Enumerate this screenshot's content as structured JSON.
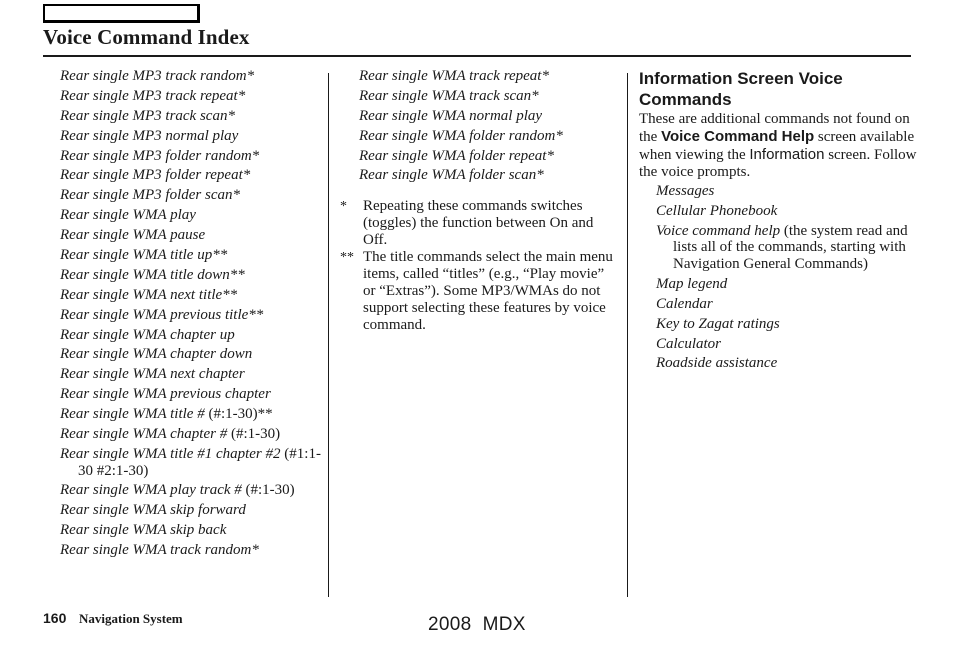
{
  "header": {
    "title": "Voice Command Index"
  },
  "column1": {
    "commands": [
      {
        "text": "Rear single MP3 track random*",
        "suffix": ""
      },
      {
        "text": "Rear single MP3 track repeat*",
        "suffix": ""
      },
      {
        "text": "Rear single MP3 track scan*",
        "suffix": ""
      },
      {
        "text": "Rear single MP3 normal play",
        "suffix": ""
      },
      {
        "text": "Rear single MP3 folder random*",
        "suffix": ""
      },
      {
        "text": "Rear single MP3 folder repeat*",
        "suffix": ""
      },
      {
        "text": "Rear single MP3 folder scan*",
        "suffix": ""
      },
      {
        "text": "Rear single WMA play",
        "suffix": ""
      },
      {
        "text": "Rear single WMA pause",
        "suffix": ""
      },
      {
        "text": "Rear single WMA title up**",
        "suffix": ""
      },
      {
        "text": "Rear single WMA title down**",
        "suffix": ""
      },
      {
        "text": "Rear single WMA next title**",
        "suffix": ""
      },
      {
        "text": "Rear single WMA previous title**",
        "suffix": ""
      },
      {
        "text": "Rear single WMA chapter up",
        "suffix": ""
      },
      {
        "text": "Rear single WMA chapter down",
        "suffix": ""
      },
      {
        "text": "Rear single WMA next chapter",
        "suffix": ""
      },
      {
        "text": "Rear single WMA previous chapter",
        "suffix": ""
      },
      {
        "text": "Rear single WMA title # ",
        "suffix": "(#:1-30)**"
      },
      {
        "text": "Rear single WMA chapter # ",
        "suffix": "(#:1-30)"
      },
      {
        "text": "Rear single WMA title #1 chapter #2 ",
        "suffix": "(#1:1-30 #2:1-30)"
      },
      {
        "text": "Rear single WMA play track # ",
        "suffix": "(#:1-30)"
      },
      {
        "text": "Rear single WMA skip forward",
        "suffix": ""
      },
      {
        "text": "Rear single WMA skip back",
        "suffix": ""
      },
      {
        "text": "Rear single WMA track random*",
        "suffix": ""
      }
    ]
  },
  "column2": {
    "commands": [
      "Rear single WMA track repeat*",
      "Rear single WMA track scan*",
      "Rear single WMA normal play",
      "Rear single WMA folder random*",
      "Rear single WMA folder repeat*",
      "Rear single WMA folder scan*"
    ],
    "notes": [
      {
        "mark": "*",
        "text": "Repeating these commands switches (toggles) the function between On and Off."
      },
      {
        "mark": "**",
        "text": "The title commands select the main menu items, called “titles” (e.g., “Play movie” or “Extras”). Some MP3/WMAs do not support selecting these features by voice command."
      }
    ]
  },
  "column3": {
    "heading": "Information Screen Voice Commands",
    "intro": {
      "part1": "These are additional commands not found on the ",
      "bold_term": "Voice Command Help",
      "part2": " screen available when viewing the ",
      "screen_term": "Information",
      "part3": " screen. Follow the voice prompts."
    },
    "commands": [
      {
        "text": "Messages",
        "note": ""
      },
      {
        "text": "Cellular Phonebook",
        "note": ""
      },
      {
        "text": "Voice command help",
        "note": " (the system read and lists all of the commands, starting with Navigation General Commands)"
      },
      {
        "text": "Map legend",
        "note": ""
      },
      {
        "text": "Calendar",
        "note": ""
      },
      {
        "text": "Key to Zagat ratings",
        "note": ""
      },
      {
        "text": "Calculator",
        "note": ""
      },
      {
        "text": "Roadside assistance",
        "note": ""
      }
    ]
  },
  "footer": {
    "page_number": "160",
    "section": "Navigation System",
    "model": "2008  MDX"
  }
}
